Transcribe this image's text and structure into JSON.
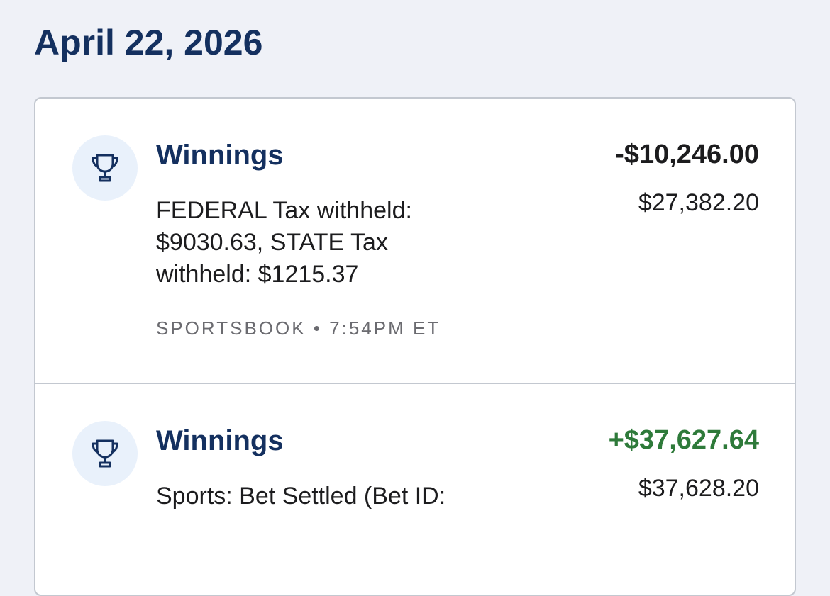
{
  "date_heading": "April 22, 2026",
  "transactions": [
    {
      "icon": "trophy-icon",
      "title": "Winnings",
      "description": "FEDERAL Tax withheld: $9030.63, STATE Tax withheld: $1215.37",
      "source": "SPORTSBOOK",
      "separator": "•",
      "time": "7:54PM ET",
      "amount": "-$10,246.00",
      "balance": "$27,382.20"
    },
    {
      "icon": "trophy-icon",
      "title": "Winnings",
      "description": "Sports: Bet Settled (Bet ID:",
      "amount": "+$37,627.64",
      "balance": "$37,628.20"
    }
  ],
  "colors": {
    "background": "#eff1f7",
    "heading": "#14305f",
    "positive": "#2e7a3a",
    "icon_circle": "#e9f1fb"
  }
}
